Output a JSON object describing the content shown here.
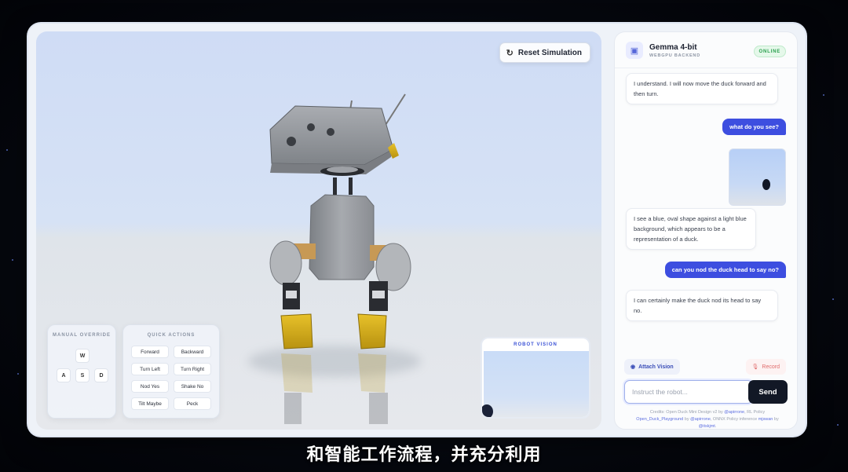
{
  "viewport": {
    "reset_label": "Reset Simulation",
    "manual_override": {
      "title": "MANUAL OVERRIDE",
      "keys": [
        "W",
        "A",
        "S",
        "D"
      ]
    },
    "quick_actions": {
      "title": "QUICK ACTIONS",
      "buttons": [
        "Forward",
        "Backward",
        "Turn Left",
        "Turn Right",
        "Nod Yes",
        "Shake No",
        "Tilt Maybe",
        "Peck"
      ]
    },
    "robot_vision_title": "ROBOT VISION"
  },
  "chat": {
    "model_name": "Gemma 4-bit",
    "model_sub": "WEBGPU BACKEND",
    "status": "ONLINE",
    "messages": [
      {
        "role": "bot",
        "text": "I understand. I will now move the duck forward and then turn."
      },
      {
        "role": "user",
        "text": "what do you see?"
      },
      {
        "role": "bot",
        "text": "I see a blue, oval shape against a light blue background, which appears to be a representation of a duck."
      },
      {
        "role": "user",
        "text": "can you nod the duck head to say no?"
      },
      {
        "role": "bot",
        "text": "I can certainly make the duck nod its head to say no."
      }
    ],
    "attach_label": "Attach Vision",
    "record_label": "Record",
    "input_placeholder": "Instruct the robot...",
    "send_label": "Send",
    "credits": {
      "p1": "Credits: Open Duck Mini Design v2 by ",
      "a1": "@apirrone",
      "p2": ", RL Policy ",
      "a2": "Open_Duck_Playground",
      "p3": " by ",
      "a3": "@apirrone",
      "p4": ", ONNX Policy inference ",
      "a4": "mjswan",
      "p5": " by ",
      "a5": "@itskjmt",
      "p6": "."
    }
  },
  "subtitle": "和智能工作流程，并充分利用",
  "colors": {
    "accent": "#3d4ee0",
    "online": "#2aa04e",
    "send": "#121826"
  }
}
